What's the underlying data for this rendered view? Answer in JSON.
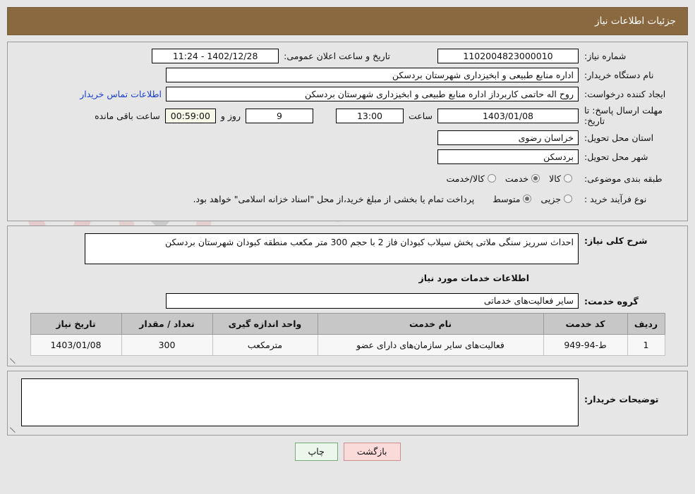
{
  "header": {
    "title": "جزئیات اطلاعات نیاز",
    "bar_color": "#8a6840"
  },
  "watermark": {
    "text": "AriaTender.net"
  },
  "top_form": {
    "need_number_label": "شماره نیاز:",
    "need_number_value": "1102004823000010",
    "announce_datetime_label": "تاریخ و ساعت اعلان عمومی:",
    "announce_datetime_value": "1402/12/28 - 11:24",
    "buyer_org_label": "نام دستگاه خریدار:",
    "buyer_org_value": "اداره منابع طبیعی و ابخیزداری شهرستان بردسکن",
    "creator_label": "ایجاد کننده درخواست:",
    "creator_value": "روح اله حاتمی کاربرداز اداره منابع طبیعی و ابخیزداری شهرستان بردسکن",
    "contact_link": "اطلاعات تماس خریدار",
    "deadline_label": "مهلت ارسال پاسخ: تا تاریخ:",
    "deadline_date": "1403/01/08",
    "deadline_time_label": "ساعت",
    "deadline_time": "13:00",
    "days_remaining": "9",
    "days_unit_label": "روز و",
    "countdown": "00:59:00",
    "countdown_suffix": "ساعت باقی مانده",
    "province_label": "استان محل تحویل:",
    "province_value": "خراسان رضوی",
    "city_label": "شهر محل تحویل:",
    "city_value": "بردسکن",
    "category_label": "طبقه بندی موضوعی:",
    "category_options": [
      {
        "label": "کالا",
        "selected": false
      },
      {
        "label": "خدمت",
        "selected": true
      },
      {
        "label": "کالا/خدمت",
        "selected": false
      }
    ],
    "process_label": "نوع فرآیند خرید :",
    "process_options": [
      {
        "label": "جزیی",
        "selected": false
      },
      {
        "label": "متوسط",
        "selected": true
      }
    ],
    "process_note": "پرداخت تمام یا بخشی از مبلغ خرید،از محل \"اسناد خزانه اسلامی\" خواهد بود."
  },
  "middle": {
    "general_desc_label": "شرح کلی نیاز:",
    "general_desc_value": "احداث سرریز سنگی ملاتی پخش سیلاب کبودان فاز 2 با حجم 300 متر مکعب منطقه کبودان شهرستان بردسکن",
    "services_section_title": "اطلاعات خدمات مورد نیاز",
    "service_group_label": "گروه خدمت:",
    "service_group_value": "سایر فعالیت‌های خدماتی",
    "table": {
      "columns": [
        "ردیف",
        "کد خدمت",
        "نام خدمت",
        "واحد اندازه گیری",
        "تعداد / مقدار",
        "تاریخ نیاز"
      ],
      "rows": [
        {
          "radif": "1",
          "code": "ط-94-949",
          "name": "فعالیت‌های سایر سازمان‌های دارای عضو",
          "unit": "مترمکعب",
          "quantity": "300",
          "need_date": "1403/01/08"
        }
      ]
    }
  },
  "bottom": {
    "buyer_notes_label": "توضیحات خریدار:",
    "buyer_notes_value": ""
  },
  "buttons": {
    "print": "چاپ",
    "back": "بازگشت"
  }
}
